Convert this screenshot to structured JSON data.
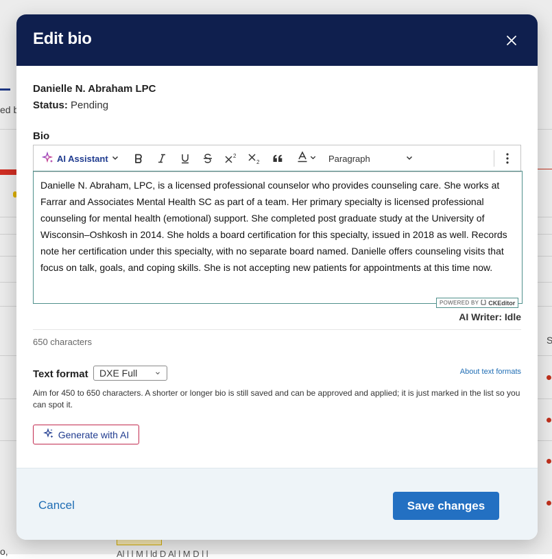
{
  "modal": {
    "title": "Edit bio",
    "provider_name": "Danielle N. Abraham LPC",
    "status_label": "Status:",
    "status_value": "Pending",
    "bio_label": "Bio"
  },
  "toolbar": {
    "ai_assistant_label": "AI Assistant",
    "paragraph_label": "Paragraph",
    "icons": [
      "sparkle-icon",
      "bold-icon",
      "italic-icon",
      "underline-icon",
      "strikethrough-icon",
      "superscript-icon",
      "subscript-icon",
      "blockquote-icon",
      "font-color-icon",
      "more-options-icon"
    ]
  },
  "editor": {
    "content": "Danielle N. Abraham, LPC, is a licensed professional counselor who provides counseling care. She works at Farrar and Associates Mental Health SC as part of a team. Her primary specialty is licensed professional counseling for mental health (emotional) support. She completed post graduate study at the University of Wisconsin–Oshkosh in 2014. She holds a board certification for this specialty, issued in 2018 as well. Records note her certification under this specialty, with no separate board named. Danielle offers counseling visits that focus on talk, goals, and coping skills. She is not accepting new patients for appointments at this time now.",
    "powered_by": "POWERED BY",
    "ckeditor": "CKEditor",
    "ai_writer_status": "AI Writer: Idle"
  },
  "char_count": "650 characters",
  "text_format": {
    "label": "Text format",
    "selected": "DXE Full",
    "about_link": "About text formats",
    "help": "Aim for 450 to 650 characters. A shorter or longer bio is still saved and can be approved and applied; it is just marked in the list so you can spot it."
  },
  "generate_button": "Generate with AI",
  "footer": {
    "cancel": "Cancel",
    "save": "Save changes"
  },
  "background": {
    "fragment_1": "ed b",
    "fragment_2": "S",
    "fragment_3": "o,",
    "bottom_text": "Al    l    l   M l     ld D Al      l   M D l      l"
  },
  "colors": {
    "header_bg": "#0f1f4e",
    "primary_button": "#2370c2",
    "link": "#1f6db4",
    "editor_border": "#4e8f8b",
    "generate_border": "#c1294e"
  }
}
